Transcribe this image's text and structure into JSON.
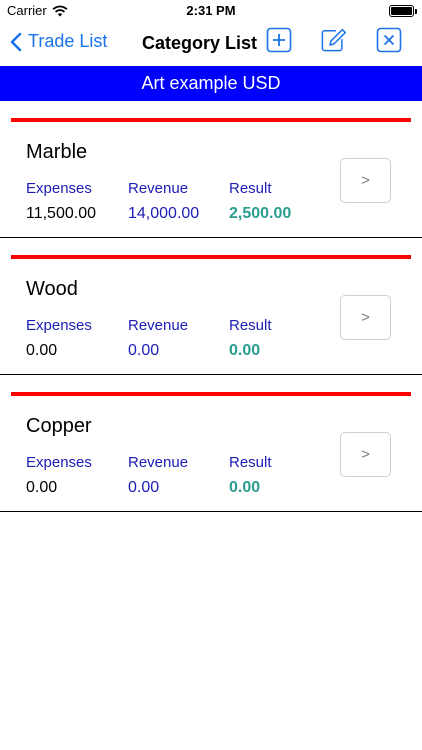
{
  "status_bar": {
    "carrier": "Carrier",
    "time": "2:31 PM",
    "battery_level": 1.0
  },
  "nav": {
    "back_label": "Trade List",
    "title": "Category List",
    "add_icon": "plus-square-icon",
    "edit_icon": "edit-pencil-icon",
    "close_icon": "close-square-icon",
    "accent": "#1a73e8"
  },
  "banner": {
    "text": "Art example USD",
    "color": "#0000ff"
  },
  "columns": {
    "expenses": "Expenses",
    "revenue": "Revenue",
    "result": "Result"
  },
  "categories": [
    {
      "name": "Marble",
      "expenses": "11,500.00",
      "revenue": "14,000.00",
      "result": "2,500.00",
      "button": ">"
    },
    {
      "name": "Wood",
      "expenses": "0.00",
      "revenue": "0.00",
      "result": "0.00",
      "button": ">"
    },
    {
      "name": "Copper",
      "expenses": "0.00",
      "revenue": "0.00",
      "result": "0.00",
      "button": ">"
    }
  ],
  "colors": {
    "divider": "#ff0000",
    "labels": "#1c1cb8",
    "result": "#2a9d8f"
  }
}
